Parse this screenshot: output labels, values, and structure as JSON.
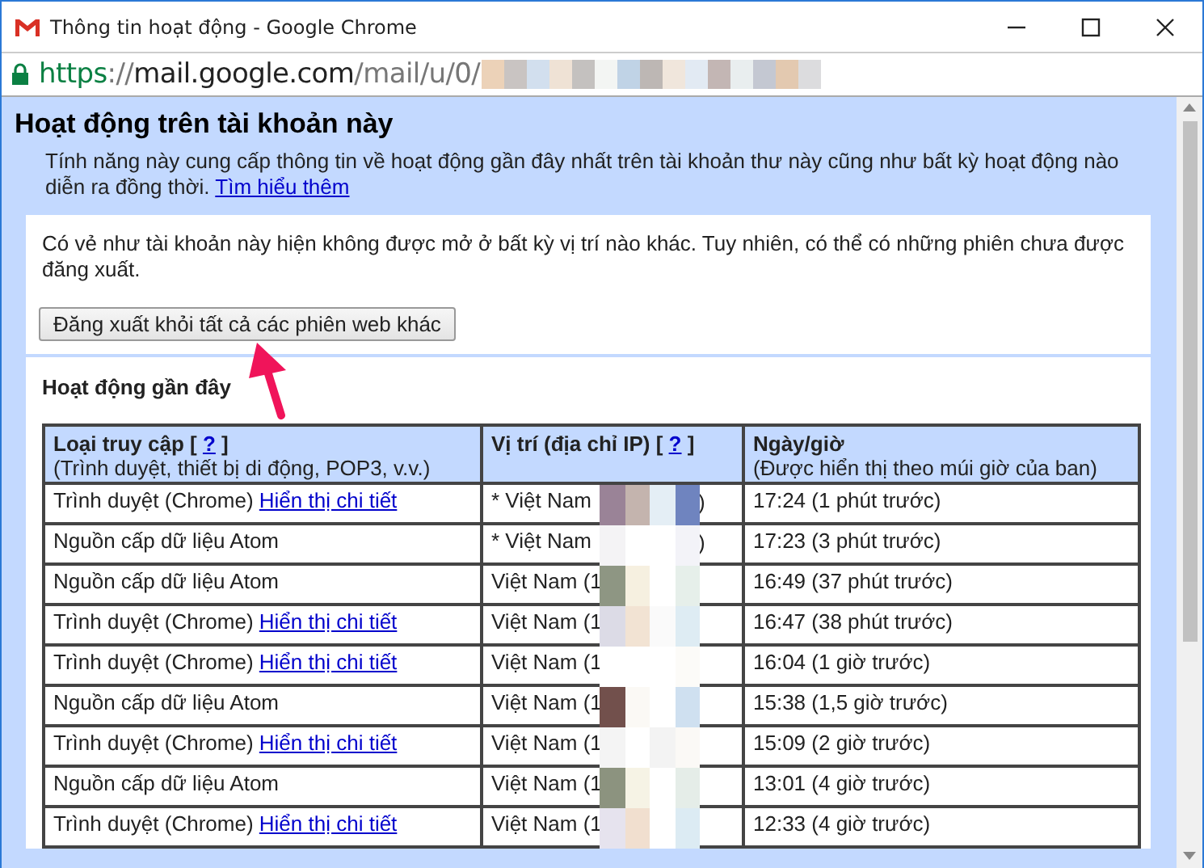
{
  "window": {
    "title": "Thông tin hoạt động - Google Chrome"
  },
  "address_bar": {
    "secure": true,
    "url_parts": [
      {
        "kind": "scheme",
        "text": "https"
      },
      {
        "kind": "dim",
        "text": "://"
      },
      {
        "kind": "host",
        "text": "mail.google.com"
      },
      {
        "kind": "dim",
        "text": "/mail/u/0/"
      }
    ]
  },
  "header": {
    "title": "Hoạt động trên tài khoản này",
    "description": "Tính năng này cung cấp thông tin về hoạt động gần đây nhất trên tài khoản thư này cũng như bất kỳ hoạt động nào diễn ra đồng thời.",
    "link": "Tìm hiểu thêm"
  },
  "notice": "Có vẻ như tài khoản này hiện không được mở ở bất kỳ vị trí nào khác. Tuy nhiên, có thể có những phiên chưa được đăng xuất.",
  "signout_button": "Đăng xuất khỏi tất cả các phiên web khác",
  "recent_title": "Hoạt động gần đây",
  "table": {
    "columns": [
      {
        "title": "Loại truy cập [",
        "help": "?",
        "title_end": "]",
        "subtitle": "(Trình duyệt, thiết bị di động, POP3, v.v.)"
      },
      {
        "title": "Vị trí (địa chỉ IP) [",
        "help": "?",
        "title_end": "]"
      },
      {
        "title": "Ngày/giờ",
        "subtitle": "(Được hiển thị theo múi giờ của ban)"
      }
    ],
    "rows": [
      {
        "access": "Trình duyệt (Chrome)",
        "link": "Hiển thị chi tiết",
        "location": "* Việt Nam",
        "location_end": ")",
        "time": "17:24 (1 phút trước)"
      },
      {
        "access": "Nguồn cấp dữ liệu Atom",
        "location": "* Việt Nam",
        "location_end": ")",
        "time": "17:23 (3 phút trước)"
      },
      {
        "access": "Nguồn cấp dữ liệu Atom",
        "location": "Việt Nam (1",
        "time": "16:49 (37 phút trước)"
      },
      {
        "access": "Trình duyệt (Chrome)",
        "link": "Hiển thị chi tiết",
        "location": "Việt Nam (1",
        "time": "16:47 (38 phút trước)"
      },
      {
        "access": "Trình duyệt (Chrome)",
        "link": "Hiển thị chi tiết",
        "location": "Việt Nam (1",
        "time": "16:04 (1 giờ trước)"
      },
      {
        "access": "Nguồn cấp dữ liệu Atom",
        "location": "Việt Nam (1",
        "time": "15:38 (1,5 giờ trước)"
      },
      {
        "access": "Trình duyệt (Chrome)",
        "link": "Hiển thị chi tiết",
        "location": "Việt Nam (1",
        "time": "15:09 (2 giờ trước)"
      },
      {
        "access": "Nguồn cấp dữ liệu Atom",
        "location": "Việt Nam (1",
        "time": "13:01 (4 giờ trước)"
      },
      {
        "access": "Trình duyệt (Chrome)",
        "link": "Hiển thị chi tiết",
        "location": "Việt Nam (1",
        "time": "12:33 (4 giờ trước)"
      }
    ]
  }
}
